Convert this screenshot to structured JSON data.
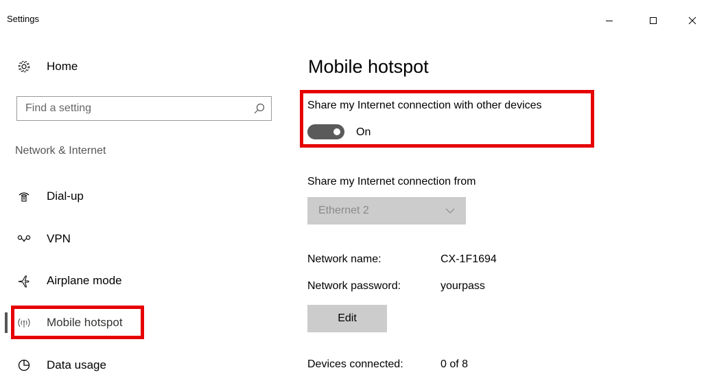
{
  "window": {
    "title": "Settings",
    "controls": {
      "minimize": "–",
      "maximize": "□",
      "close": "×"
    }
  },
  "sidebar": {
    "home_label": "Home",
    "search": {
      "placeholder": "Find a setting",
      "value": ""
    },
    "section_label": "Network & Internet",
    "items": [
      {
        "label": "Dial-up",
        "icon": "dialup-icon"
      },
      {
        "label": "VPN",
        "icon": "vpn-icon"
      },
      {
        "label": "Airplane mode",
        "icon": "airplane-icon"
      },
      {
        "label": "Mobile hotspot",
        "icon": "hotspot-icon",
        "selected": true
      },
      {
        "label": "Data usage",
        "icon": "data-usage-icon"
      }
    ]
  },
  "main": {
    "title": "Mobile hotspot",
    "share_toggle": {
      "label": "Share my Internet connection with other devices",
      "state_label": "On",
      "on": true
    },
    "share_from": {
      "label": "Share my Internet connection from",
      "selected": "Ethernet 2"
    },
    "network_name": {
      "label": "Network name:",
      "value": "CX-1F1694"
    },
    "network_password": {
      "label": "Network password:",
      "value": "yourpass"
    },
    "edit_label": "Edit",
    "devices_connected": {
      "label": "Devices connected:",
      "value": "0 of 8"
    }
  },
  "colors": {
    "highlight": "#e60000",
    "toggle_on": "#5a5a5a",
    "control_gray": "#cccccc"
  }
}
